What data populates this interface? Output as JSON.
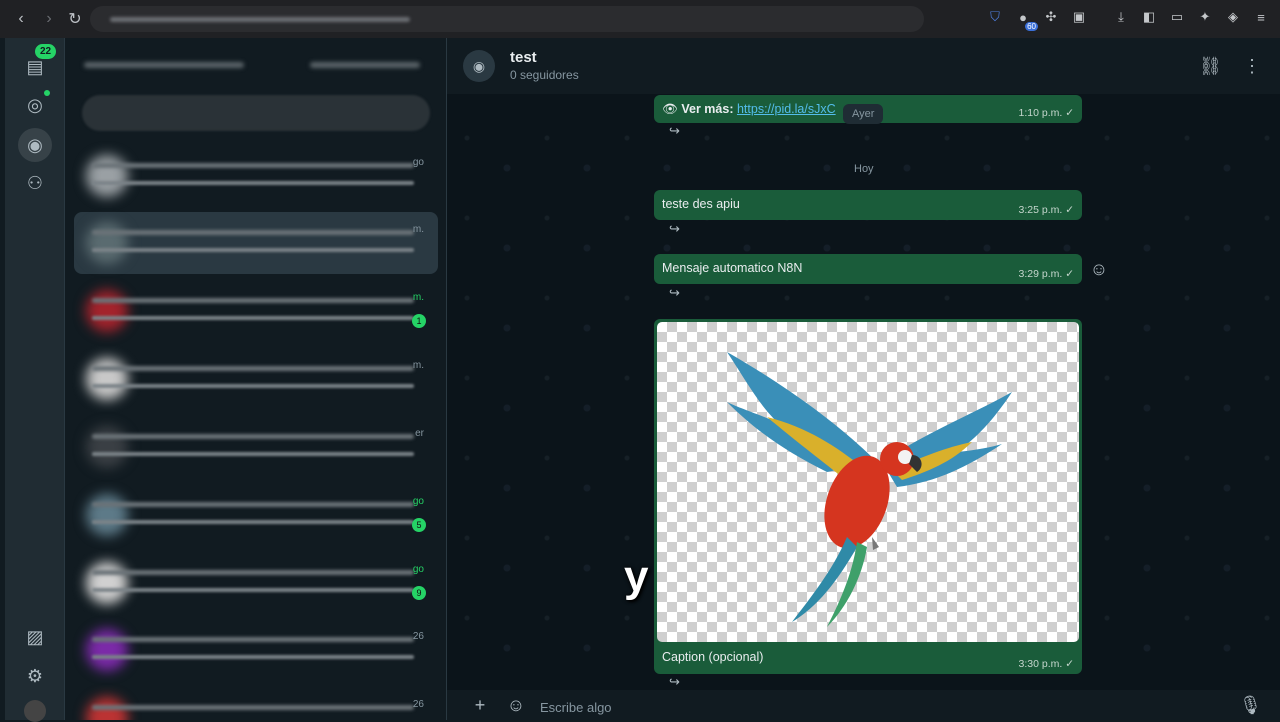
{
  "browser": {
    "back_icon": "back-arrow-icon",
    "forward_icon": "forward-arrow-icon",
    "reload_icon": "reload-icon",
    "extension_badge": "60"
  },
  "rail": {
    "chats_badge": "22",
    "items": [
      "chats",
      "status",
      "channels",
      "communities",
      "media",
      "settings",
      "profile"
    ]
  },
  "chat_list": {
    "rows": [
      {
        "meta": "go",
        "badge": ""
      },
      {
        "meta": "m.",
        "badge": ""
      },
      {
        "meta": "m.",
        "badge": "1"
      },
      {
        "meta": "m.",
        "badge": ""
      },
      {
        "meta": "er",
        "badge": ""
      },
      {
        "meta": "go",
        "badge": "5"
      },
      {
        "meta": "go",
        "badge": "9"
      },
      {
        "meta": "26",
        "badge": ""
      },
      {
        "meta": "26",
        "badge": ""
      }
    ]
  },
  "channel": {
    "title": "test",
    "subtitle": "0 seguidores"
  },
  "messages": {
    "m1_prefix": "Ver más:",
    "m1_link": "https://pid.la/sJxC",
    "m1_time": "1:10 p.m. ✓",
    "day_yesterday": "Ayer",
    "day_today": "Hoy",
    "m2_text": "teste des apiu",
    "m2_time": "3:25 p.m. ✓",
    "m3_text": "Mensaje automatico N8N",
    "m3_time": "3:29 p.m. ✓",
    "m4_caption": "Caption (opcional)",
    "m4_time": "3:30 p.m. ✓"
  },
  "composer": {
    "placeholder": "Escribe algo"
  },
  "overlay_subtitle": "y",
  "colors": {
    "accent": "#25d366",
    "outgoing_bubble": "#1a5c3a",
    "background": "#0b141a"
  }
}
